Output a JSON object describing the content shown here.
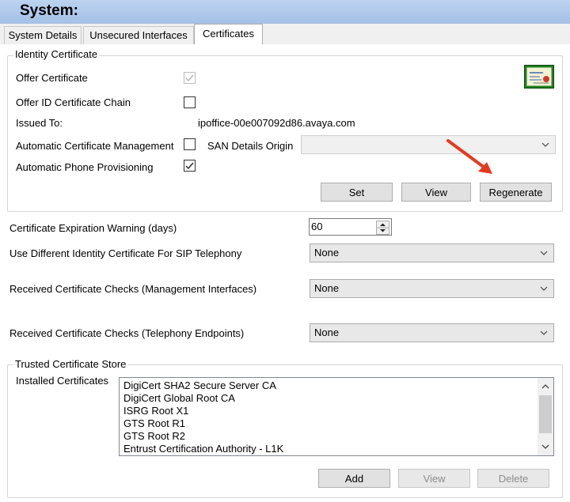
{
  "window": {
    "title": "System:"
  },
  "tabs": [
    {
      "label": "System Details",
      "active": false
    },
    {
      "label": "Unsecured Interfaces",
      "active": false
    },
    {
      "label": "Certificates",
      "active": true
    }
  ],
  "identity": {
    "legend": "Identity Certificate",
    "offer_certificate": {
      "label": "Offer Certificate",
      "checked": true,
      "enabled": false
    },
    "offer_chain": {
      "label": "Offer ID Certificate Chain",
      "checked": false
    },
    "issued_to": {
      "label": "Issued To:",
      "value": "ipoffice-00e007092d86.avaya.com"
    },
    "auto_mgmt": {
      "label": "Automatic Certificate Management",
      "checked": false
    },
    "san_origin": {
      "label": "SAN Details Origin",
      "value": ""
    },
    "auto_phone": {
      "label": "Automatic Phone Provisioning",
      "checked": true
    },
    "buttons": {
      "set": "Set",
      "view": "View",
      "regenerate": "Regenerate"
    },
    "certificate_icon": "certificate-icon",
    "annotation": {
      "arrow_color": "#e53a1e"
    }
  },
  "expiration": {
    "label": "Certificate Expiration Warning (days)",
    "value": "60"
  },
  "sip_identity": {
    "label": "Use Different Identity Certificate For SIP Telephony",
    "value": "None"
  },
  "checks_mgmt": {
    "label": "Received Certificate Checks (Management Interfaces)",
    "value": "None"
  },
  "checks_tel": {
    "label": "Received Certificate Checks (Telephony Endpoints)",
    "value": "None"
  },
  "trusted": {
    "legend": "Trusted Certificate Store",
    "installed_label": "Installed Certificates",
    "certificates": [
      "DigiCert SHA2 Secure Server CA",
      "DigiCert Global Root CA",
      "ISRG Root X1",
      "GTS Root R1",
      "GTS Root R2",
      "Entrust Certification Authority - L1K"
    ],
    "buttons": {
      "add": "Add",
      "view": "View",
      "delete": "Delete"
    }
  },
  "colors": {
    "header_bg": "#b2c9ea",
    "arrow": "#e53a1e"
  }
}
